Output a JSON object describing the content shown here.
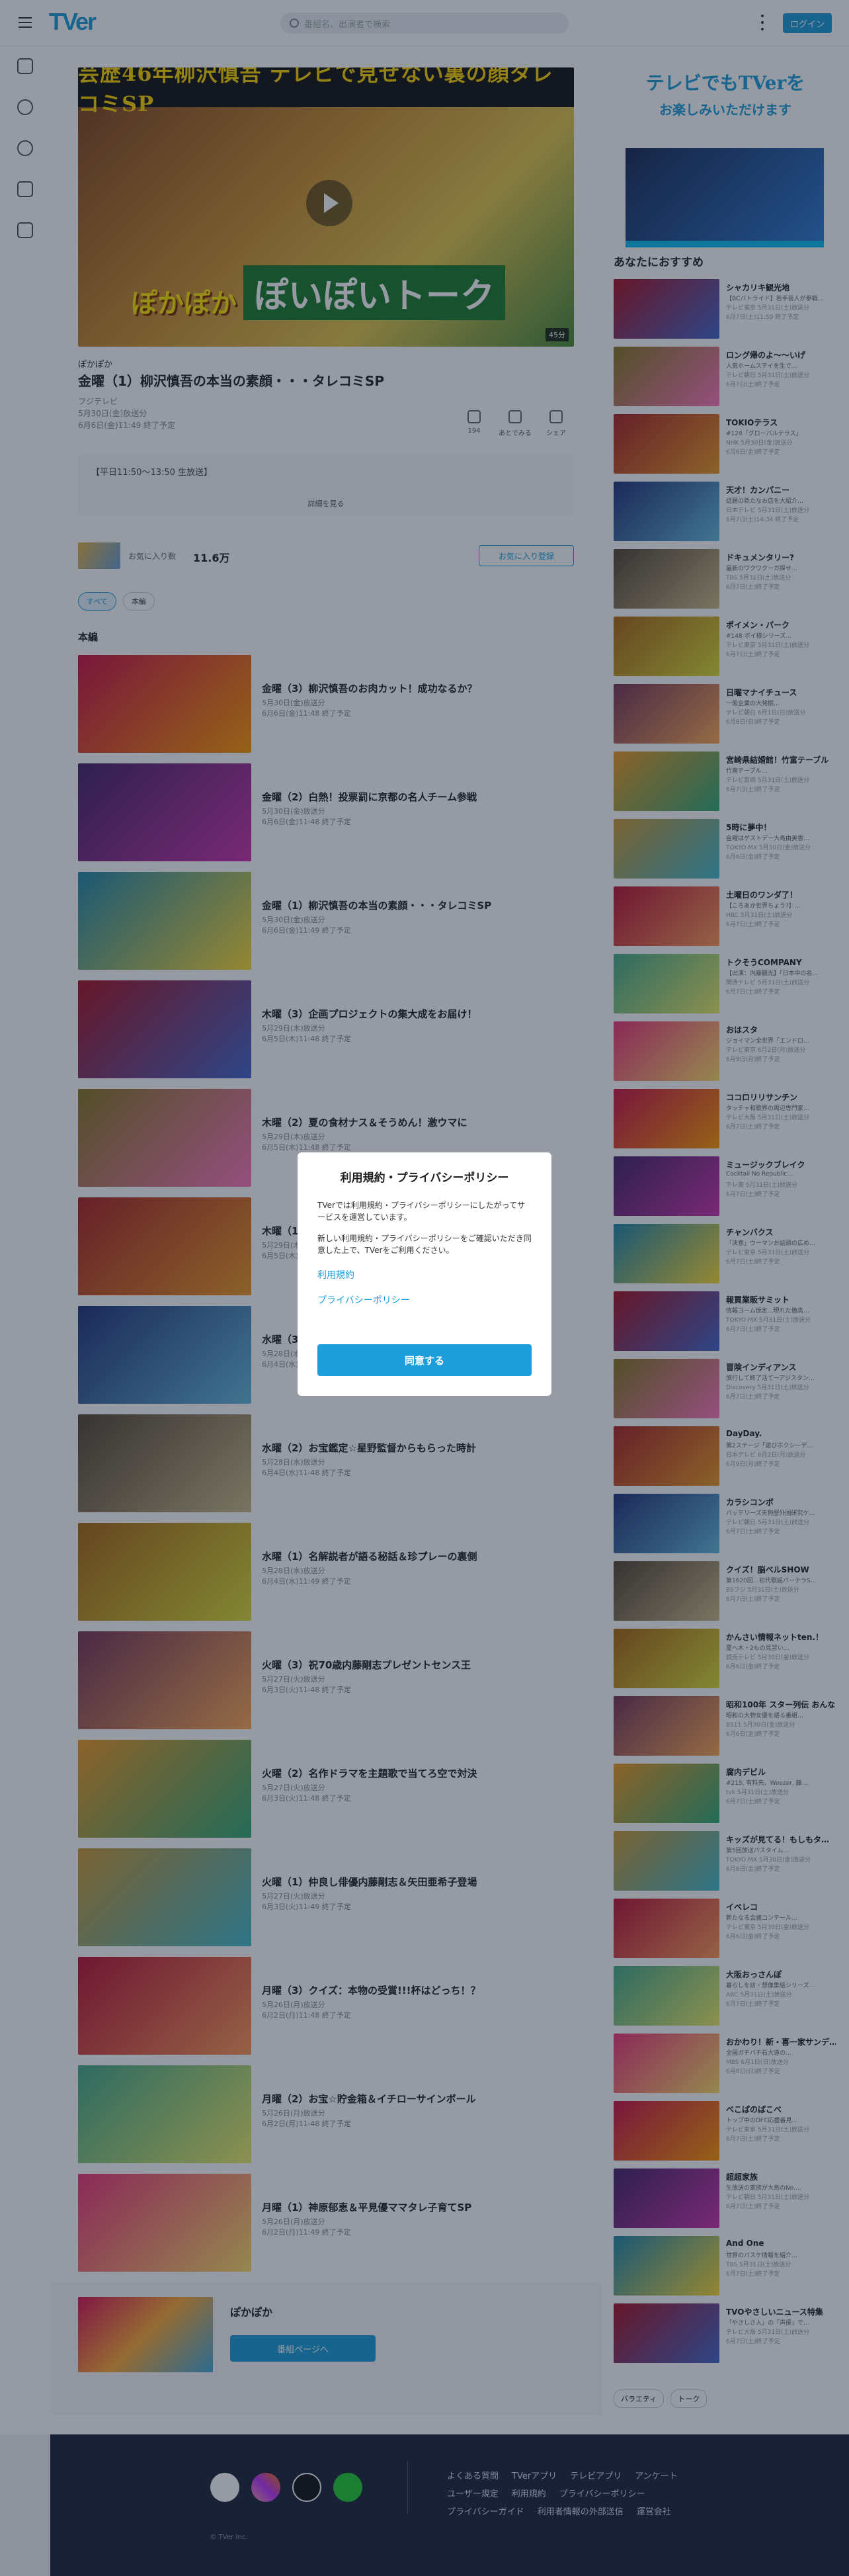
{
  "header": {
    "logo": "TVer",
    "search_placeholder": "番組名、出演者で検索",
    "login": "ログイン"
  },
  "hero": {
    "title": "芸歴46年柳沢慎吾 テレビで見せない裏の顔タレコミSP",
    "logo": "ぽかぽか",
    "subtitle": "ぽいぽいトーク",
    "duration": "45分"
  },
  "episode": {
    "series": "ぽかぽか",
    "title": "金曜（1）柳沢慎吾の本当の素顔・・・タレコミSP",
    "channel": "フジテレビ",
    "aired": "5月30日(金)放送分",
    "expires": "6月6日(金)11:49 終了予定",
    "actions": [
      {
        "label": "いいね",
        "count": "194"
      },
      {
        "label": "あとでみる"
      },
      {
        "label": "シェア"
      }
    ],
    "description": "【平日11:50～13:50 生放送】",
    "more": "詳細を見る"
  },
  "favorites": {
    "label": "お気に入り数",
    "count": "11.6万",
    "button": "お気に入り登録"
  },
  "filters": [
    "すべて",
    "本編"
  ],
  "section_label": "本編",
  "episodes": [
    {
      "title": "金曜（3）柳沢慎吾のお肉カット！成功なるか？",
      "date": "5月30日(金)放送分",
      "expires": "6月6日(金)11:48 終了予定"
    },
    {
      "title": "金曜（2）白熱！投票罰に京都の名人チーム参戦",
      "date": "5月30日(金)放送分",
      "expires": "6月6日(金)11:48 終了予定"
    },
    {
      "title": "金曜（1）柳沢慎吾の本当の素顔・・・タレコミSP",
      "date": "5月30日(金)放送分",
      "expires": "6月6日(金)11:49 終了予定"
    },
    {
      "title": "木曜（3）企画プロジェクトの集大成をお届け！",
      "date": "5月29日(木)放送分",
      "expires": "6月5日(木)11:48 終了予定"
    },
    {
      "title": "木曜（2）夏の食材ナス＆そうめん！激ウマに",
      "date": "5月29日(木)放送分",
      "expires": "6月5日(木)11:48 終了予定"
    },
    {
      "title": "木曜（1）",
      "date": "5月29日(木)放送分",
      "expires": "6月5日(木)11:48 終了予定"
    },
    {
      "title": "水曜（3）",
      "date": "5月28日(水)放送分",
      "expires": "6月4日(水)11:48 終了予定"
    },
    {
      "title": "水曜（2）お宝鑑定☆星野監督からもらった時計",
      "date": "5月28日(水)放送分",
      "expires": "6月4日(水)11:48 終了予定"
    },
    {
      "title": "水曜（1）名解説者が語る秘話＆珍プレーの裏側",
      "date": "5月28日(水)放送分",
      "expires": "6月4日(水)11:49 終了予定"
    },
    {
      "title": "火曜（3）祝70歳内藤剛志プレゼントセンス王",
      "date": "5月27日(火)放送分",
      "expires": "6月3日(火)11:48 終了予定"
    },
    {
      "title": "火曜（2）名作ドラマを主題歌で当てろ空で対決",
      "date": "5月27日(火)放送分",
      "expires": "6月3日(火)11:48 終了予定"
    },
    {
      "title": "火曜（1）仲良し俳優内藤剛志＆矢田亜希子登場",
      "date": "5月27日(火)放送分",
      "expires": "6月3日(火)11:49 終了予定"
    },
    {
      "title": "月曜（3）クイズ：本物の受賞!!!杯はどっち！？",
      "date": "5月26日(月)放送分",
      "expires": "6月2日(月)11:48 終了予定"
    },
    {
      "title": "月曜（2）お宝☆貯金箱＆イチローサインボール",
      "date": "5月26日(月)放送分",
      "expires": "6月2日(月)11:48 終了予定"
    },
    {
      "title": "月曜（1）神原郁恵＆平見優ママタレ子育てSP",
      "date": "5月26日(月)放送分",
      "expires": "6月2日(月)11:49 終了予定"
    }
  ],
  "series_box": {
    "name": "ぽかぽか",
    "button": "番組ページへ"
  },
  "ad": {
    "line1": "テレビでもTVerを",
    "line2": "お楽しみいただけます"
  },
  "recommend_title": "あなたにおすすめ",
  "recommendations": [
    {
      "title": "シャカリキ観光地",
      "desc": "【BCバトライド】若手芸人が参戦…",
      "ch": "テレビ東京 5月31日(土)放送分",
      "exp": "6月7日(土)11:59 終了予定"
    },
    {
      "title": "ロング帰のよ～～いげ",
      "desc": "人気ホームステイを生で…",
      "ch": "テレビ朝日 5月31日(土)放送分",
      "exp": "6月7日(土)終了予定"
    },
    {
      "title": "TOKIOテラス",
      "desc": "#128「グローバルテラス」",
      "ch": "NHK 5月30日(金)放送分",
      "exp": "6月6日(金)終了予定"
    },
    {
      "title": "天才！カンパニー",
      "desc": "話題の新たなお店を大紹介…",
      "ch": "日本テレビ 5月31日(土)放送分",
      "exp": "6月7日(土)14:34 終了予定"
    },
    {
      "title": "ドキュメンタリー?",
      "desc": "最新のワクワクーガ探せ…",
      "ch": "TBS 5月31日(土)放送分",
      "exp": "6月7日(土)終了予定"
    },
    {
      "title": "ポイメン・パーク",
      "desc": "#148 ボイ様シリーズ…",
      "ch": "テレビ東京 5月31日(土)放送分",
      "exp": "6月7日(土)終了予定"
    },
    {
      "title": "日曜マナイチュース",
      "desc": "一般企業の大発掘…",
      "ch": "テレビ朝日 6月1日(日)放送分",
      "exp": "6月8日(日)終了予定"
    },
    {
      "title": "宮崎県結婚館！竹富テーブル",
      "desc": "竹富テーブル…",
      "ch": "テレビ宮崎 5月31日(土)放送分",
      "exp": "6月7日(土)終了予定"
    },
    {
      "title": "5時に夢中！",
      "desc": "金曜はゲストデー大島由美香…",
      "ch": "TOKYO MX 5月30日(金)放送分",
      "exp": "6月6日(金)終了予定"
    },
    {
      "title": "土曜日のワンダ了！",
      "desc": "【ころあか世界ちょう?】…",
      "ch": "HBC 5月31日(土)放送分",
      "exp": "6月7日(土)終了予定"
    },
    {
      "title": "トクそうCOMPANY",
      "desc": "【出演：内藤鶴光】「日本中の名…",
      "ch": "関西テレビ 5月31日(土)放送分",
      "exp": "6月7日(土)終了予定"
    },
    {
      "title": "おはスタ",
      "desc": "ジョイマン全世界「エンドロ…",
      "ch": "テレビ東京 6月2日(月)放送分",
      "exp": "6月9日(月)終了予定"
    },
    {
      "title": "ココロリリサンチン",
      "desc": "タッチャ和歌界の周辺専門家…",
      "ch": "テレビ大阪 5月31日(土)放送分",
      "exp": "6月7日(土)終了予定"
    },
    {
      "title": "ミュージックブレイク",
      "desc": "Cocktail No Republic…",
      "ch": "テレ東 5月31日(土)放送分",
      "exp": "6月7日(土)終了予定"
    },
    {
      "title": "チャンバクス",
      "desc": "「決意」ウーマンお話頭の広め…",
      "ch": "テレビ東京 5月31日(土)放送分",
      "exp": "6月7日(土)終了予定"
    },
    {
      "title": "報買業販サミット",
      "desc": "情報ヨーム仮定…現れた儀高…",
      "ch": "TOKYO MX 5月31日(土)放送分",
      "exp": "6月7日(土)終了予定"
    },
    {
      "title": "冒険インディアンス",
      "desc": "旅行して終了活てーアジスタン…",
      "ch": "Discovery 5月31日(土)放送分",
      "exp": "6月7日(土)終了予定"
    },
    {
      "title": "DayDay.",
      "desc": "第2ステージ「遊びホクシーデ…",
      "ch": "日本テレビ 6月2日(月)放送分",
      "exp": "6月9日(月)終了予定"
    },
    {
      "title": "カラシコンボ",
      "desc": "バッテリーズ天狗歴外国研究ケ…",
      "ch": "テレビ朝日 5月31日(土)放送分",
      "exp": "6月7日(土)終了予定"
    },
    {
      "title": "クイズ！脳ベルSHOW",
      "desc": "第1620回…初代歌謡パーテラS…",
      "ch": "BSフジ 5月31日(土)放送分",
      "exp": "6月7日(土)終了予定"
    },
    {
      "title": "かんさい情報ネットten.！",
      "desc": "夏へ木・2もの見習い…",
      "ch": "読売テレビ 5月30日(金)放送分",
      "exp": "6月6日(金)終了予定"
    },
    {
      "title": "昭和100年 スター列伝 おんな…",
      "desc": "昭和の大物女優を語る番組…",
      "ch": "BS11 5月30日(金)放送分",
      "exp": "6月6日(金)終了予定"
    },
    {
      "title": "腐内デビル",
      "desc": "#215, 有料先、Weezer, 藤…",
      "ch": "tvk 5月31日(土)放送分",
      "exp": "6月7日(土)終了予定"
    },
    {
      "title": "キッズが見てる！もしもタ…",
      "desc": "第5回放送バスタイム…",
      "ch": "TOKYO MX 5月30日(金)放送分",
      "exp": "6月6日(金)終了予定"
    },
    {
      "title": "イベレコ",
      "desc": "新たなる会議コンテール…",
      "ch": "テレビ東京 5月30日(金)放送分",
      "exp": "6月6日(金)終了予定"
    },
    {
      "title": "大阪おっさんぽ",
      "desc": "暮らしを訪・想像集結シリーズ…",
      "ch": "ABC 5月31日(土)放送分",
      "exp": "6月7日(土)終了予定"
    },
    {
      "title": "おかわり！新・喜一家サンデ…",
      "desc": "全国ガチバチ石大道の…",
      "ch": "MBS 6月1日(日)放送分",
      "exp": "6月8日(日)終了予定"
    },
    {
      "title": "べこぱのぱこべ",
      "desc": "トップ中のDFC応援番見…",
      "ch": "テレビ東京 5月31日(土)放送分",
      "exp": "6月7日(土)終了予定"
    },
    {
      "title": "超超家族",
      "desc": "生放送の家族が大鳥のNo.…",
      "ch": "テレビ朝日 5月31日(土)放送分",
      "exp": "6月7日(土)終了予定"
    },
    {
      "title": "And One",
      "desc": "世界のバスケ情報を紹介…",
      "ch": "TBS 5月31日(土)放送分",
      "exp": "6月7日(土)終了予定"
    },
    {
      "title": "TVOやさしいニュース特集",
      "desc": "「やさしさ人」の「声援」で…",
      "ch": "テレビ大阪 5月31日(土)放送分",
      "exp": "6月7日(土)終了予定"
    }
  ],
  "tags": [
    "バラエティ",
    "トーク"
  ],
  "footer": {
    "links": [
      "よくある質問",
      "TVerアプリ",
      "テレビアプリ",
      "アンケート",
      "ユーザー規定",
      "利用規約",
      "プライバシーポリシー",
      "プライバシーガイド",
      "利用者情報の外部送信",
      "運営会社"
    ],
    "copyright": "© TVer Inc."
  },
  "modal": {
    "title": "利用規約・プライバシーポリシー",
    "body1": "TVerでは利用規約・プライバシーポリシーにしたがってサービスを運営しています。",
    "body2": "新しい利用規約・プライバシーポリシーをご確認いただき同意した上で、TVerをご利用ください。",
    "link1": "利用規約",
    "link2": "プライバシーポリシー",
    "agree": "同意する"
  },
  "colors": {
    "accent": "#1b9ed9",
    "footer": "#1c2439"
  }
}
